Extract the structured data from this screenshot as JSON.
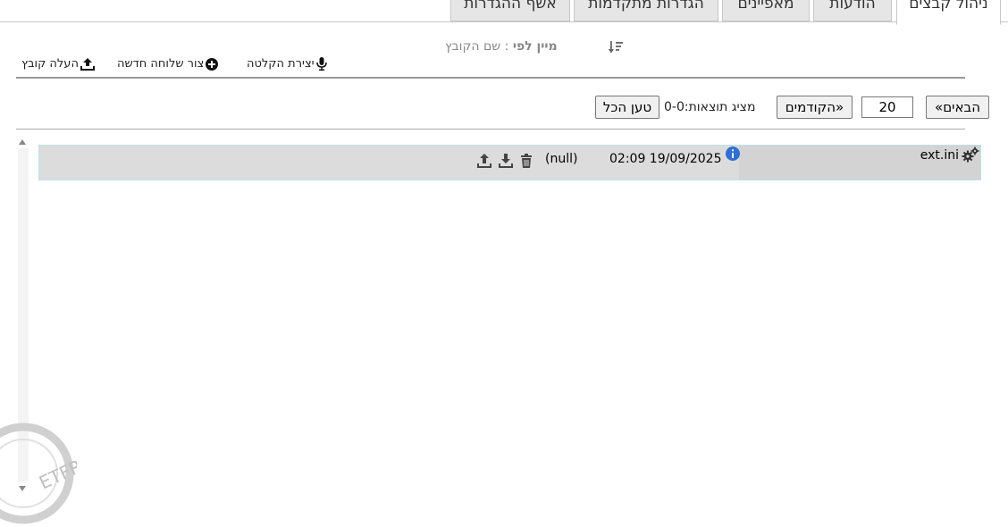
{
  "tabs": [
    {
      "label": "ניהול קבצים",
      "active": true
    },
    {
      "label": "הודעות",
      "active": false
    },
    {
      "label": "מאפיינים",
      "active": false
    },
    {
      "label": "הגדרות מתקדמות",
      "active": false
    },
    {
      "label": "אשף ההגדרות",
      "active": false
    }
  ],
  "toolbar": {
    "upload_label": "העלה קובץ",
    "new_extension_label": "צור שלוחה חדשה",
    "recording_label": "יצירת הקלטה",
    "sort_by_label": "מיין לפי",
    "sort_value": ": שם הקובץ"
  },
  "pagination": {
    "next_label": "«הבאים",
    "page_size": "20",
    "prev_label": "הקודמים»",
    "status": "מציג תוצאות:0-0",
    "load_all_label": "טען הכל"
  },
  "files": [
    {
      "name": "ext.ini",
      "date": "02:09 19/09/2025",
      "size": "(null)"
    }
  ],
  "icons": {
    "gear": "gear-icon",
    "info": "info-icon",
    "upload": "upload-icon",
    "download": "download-icon",
    "delete": "trash-icon",
    "mic": "microphone-icon",
    "plus": "plus-circle-icon",
    "sort": "sort-icon"
  },
  "colors": {
    "info": "#2f6fd6",
    "row_bg": "#dcdcdc",
    "row_border": "#b9e2ea"
  },
  "watermark_text": "ETFREE"
}
